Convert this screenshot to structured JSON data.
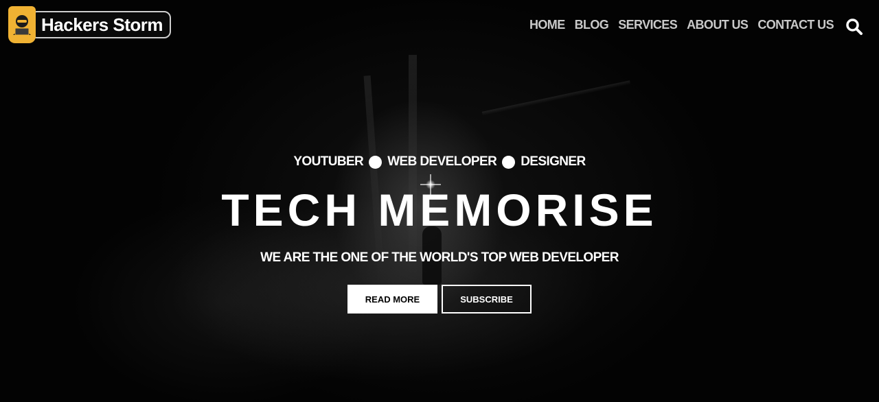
{
  "brand": {
    "name": "Hackers Storm",
    "icon": "hacker-laptop-icon",
    "badge_color": "#f0b233"
  },
  "nav": {
    "items": [
      {
        "label": "HOME"
      },
      {
        "label": "BLOG"
      },
      {
        "label": "SERVICES"
      },
      {
        "label": "ABOUT US"
      },
      {
        "label": "CONTACT US"
      }
    ],
    "search_icon": "search-icon"
  },
  "hero": {
    "tagline": [
      "YOUTUBER",
      "WEB DEVELOPER",
      "DESIGNER"
    ],
    "title": "TECH MEMORISE",
    "subtitle": "WE ARE THE ONE OF THE WORLD'S TOP WEB DEVELOPER",
    "buttons": {
      "read_more": "READ MORE",
      "subscribe": "SUBSCRIBE"
    }
  }
}
